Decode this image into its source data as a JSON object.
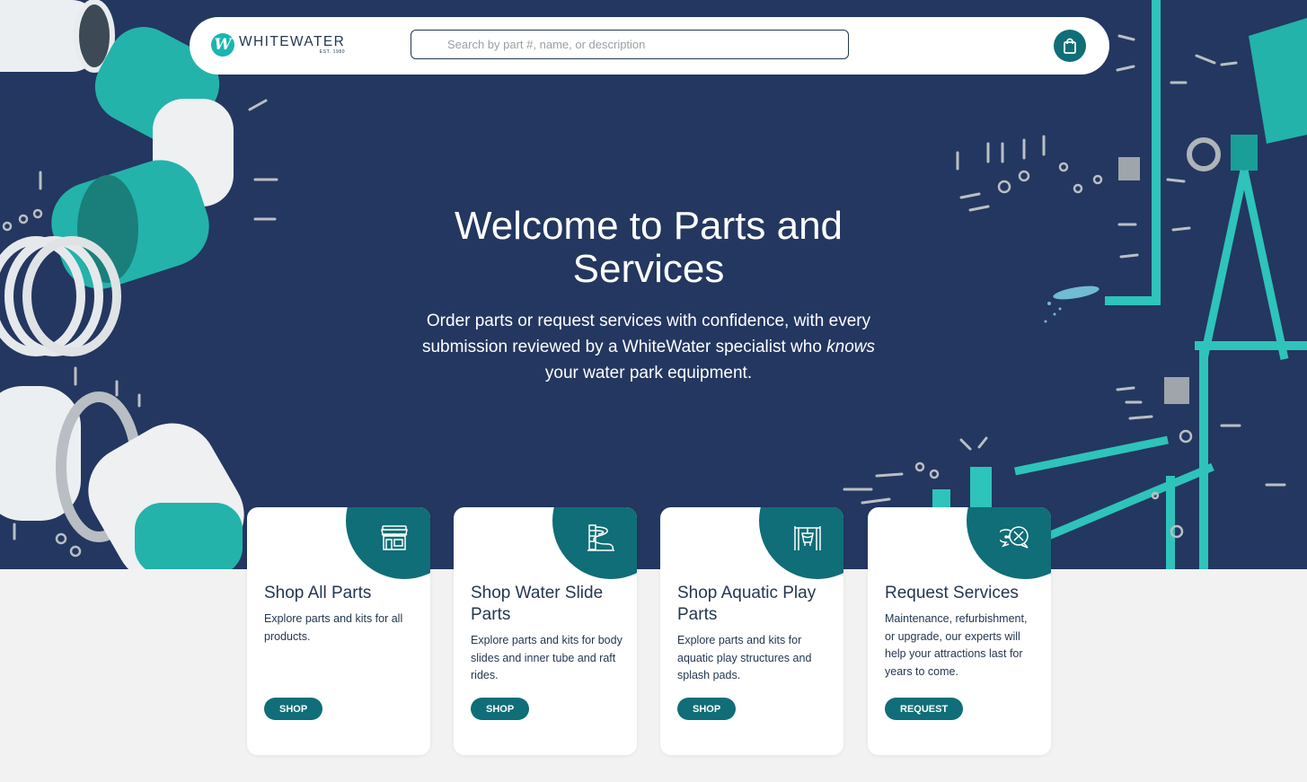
{
  "brand": {
    "name": "WHITEWATER",
    "mark": "W",
    "tagline": "EST. 1980"
  },
  "search": {
    "placeholder": "Search by part #, name, or description",
    "value": ""
  },
  "hero": {
    "title": "Welcome to Parts and Services",
    "subtitle_before": "Order parts or request services with confidence, with every submission reviewed by a WhiteWater specialist who ",
    "subtitle_emphasis": "knows",
    "subtitle_after": " your water park equipment."
  },
  "cards": [
    {
      "title": "Shop All Parts",
      "description": "Explore parts and kits for all products.",
      "button": "SHOP",
      "icon": "storefront-icon"
    },
    {
      "title": "Shop Water Slide Parts",
      "description": "Explore parts and kits for body slides and inner tube and raft rides.",
      "button": "SHOP",
      "icon": "water-slide-icon"
    },
    {
      "title": "Shop Aquatic Play Parts",
      "description": "Explore parts and kits for aquatic play structures and splash pads.",
      "button": "SHOP",
      "icon": "aquatic-play-icon"
    },
    {
      "title": "Request Services",
      "description": "Maintenance, refurbishment, or upgrade, our experts will help your attractions last for years to come.",
      "button": "REQUEST",
      "icon": "service-chat-icon"
    }
  ],
  "colors": {
    "navy": "#233760",
    "teal": "#0f6e77",
    "accent": "#1bb5b0",
    "surface": "#f2f2f2"
  }
}
